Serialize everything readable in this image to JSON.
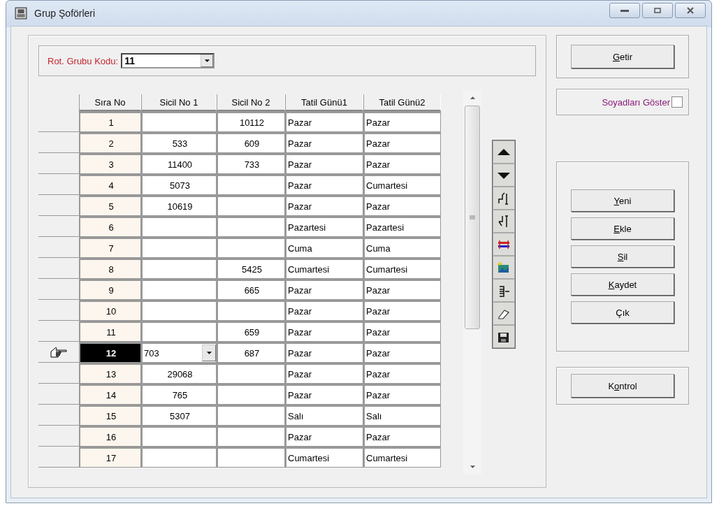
{
  "window": {
    "title": "Grup Şoförleri"
  },
  "filter": {
    "label": "Rot. Grubu Kodu:",
    "value": "11"
  },
  "table": {
    "columns": [
      "Sıra No",
      "Sicil No 1",
      "Sicil No 2",
      "Tatil Günü1",
      "Tatil Günü2"
    ],
    "rows": [
      {
        "selected": false,
        "cells": [
          "1",
          "",
          "10112",
          "Pazar",
          "Pazar"
        ]
      },
      {
        "selected": false,
        "cells": [
          "2",
          "533",
          "609",
          "Pazar",
          "Pazar"
        ]
      },
      {
        "selected": false,
        "cells": [
          "3",
          "11400",
          "733",
          "Pazar",
          "Pazar"
        ]
      },
      {
        "selected": false,
        "cells": [
          "4",
          "5073",
          "",
          "Pazar",
          "Cumartesi"
        ]
      },
      {
        "selected": false,
        "cells": [
          "5",
          "10619",
          "",
          "Pazar",
          "Pazar"
        ]
      },
      {
        "selected": false,
        "cells": [
          "6",
          "",
          "",
          "Pazartesi",
          "Pazartesi"
        ]
      },
      {
        "selected": false,
        "cells": [
          "7",
          "",
          "",
          "Cuma",
          "Cuma"
        ]
      },
      {
        "selected": false,
        "cells": [
          "8",
          "",
          "5425",
          "Cumartesi",
          "Cumartesi"
        ]
      },
      {
        "selected": false,
        "cells": [
          "9",
          "",
          "665",
          "Pazar",
          "Pazar"
        ]
      },
      {
        "selected": false,
        "cells": [
          "10",
          "",
          "",
          "Pazar",
          "Pazar"
        ]
      },
      {
        "selected": false,
        "cells": [
          "11",
          "",
          "659",
          "Pazar",
          "Pazar"
        ]
      },
      {
        "selected": true,
        "cells": [
          "12",
          "703",
          "687",
          "Pazar",
          "Pazar"
        ]
      },
      {
        "selected": false,
        "cells": [
          "13",
          "29068",
          "",
          "Pazar",
          "Pazar"
        ]
      },
      {
        "selected": false,
        "cells": [
          "14",
          "765",
          "",
          "Pazar",
          "Pazar"
        ]
      },
      {
        "selected": false,
        "cells": [
          "15",
          "5307",
          "",
          "Salı",
          "Salı"
        ]
      },
      {
        "selected": false,
        "cells": [
          "16",
          "",
          "",
          "Pazar",
          "Pazar"
        ]
      },
      {
        "selected": false,
        "cells": [
          "17",
          "",
          "",
          "Cumartesi",
          "Cumartesi"
        ]
      }
    ]
  },
  "toolbar": [
    {
      "kind": "up"
    },
    {
      "kind": "down"
    },
    {
      "kind": "insert-above"
    },
    {
      "kind": "insert-below"
    },
    {
      "kind": "swap"
    },
    {
      "kind": "image"
    },
    {
      "kind": "list"
    },
    {
      "kind": "eraser"
    },
    {
      "kind": "save"
    }
  ],
  "fetch_button": {
    "key": "G",
    "post": "etir"
  },
  "surname_toggle": {
    "label": "Soyadları Göster",
    "checked": false
  },
  "action_buttons": [
    {
      "key": "Y",
      "post": "eni"
    },
    {
      "key": "E",
      "post": "kle"
    },
    {
      "key": "S",
      "post": "il"
    },
    {
      "key": "K",
      "post": "aydet"
    },
    {
      "pre": "Çık"
    }
  ],
  "check_button": {
    "pre": "K",
    "key": "o",
    "post": "ntrol"
  }
}
